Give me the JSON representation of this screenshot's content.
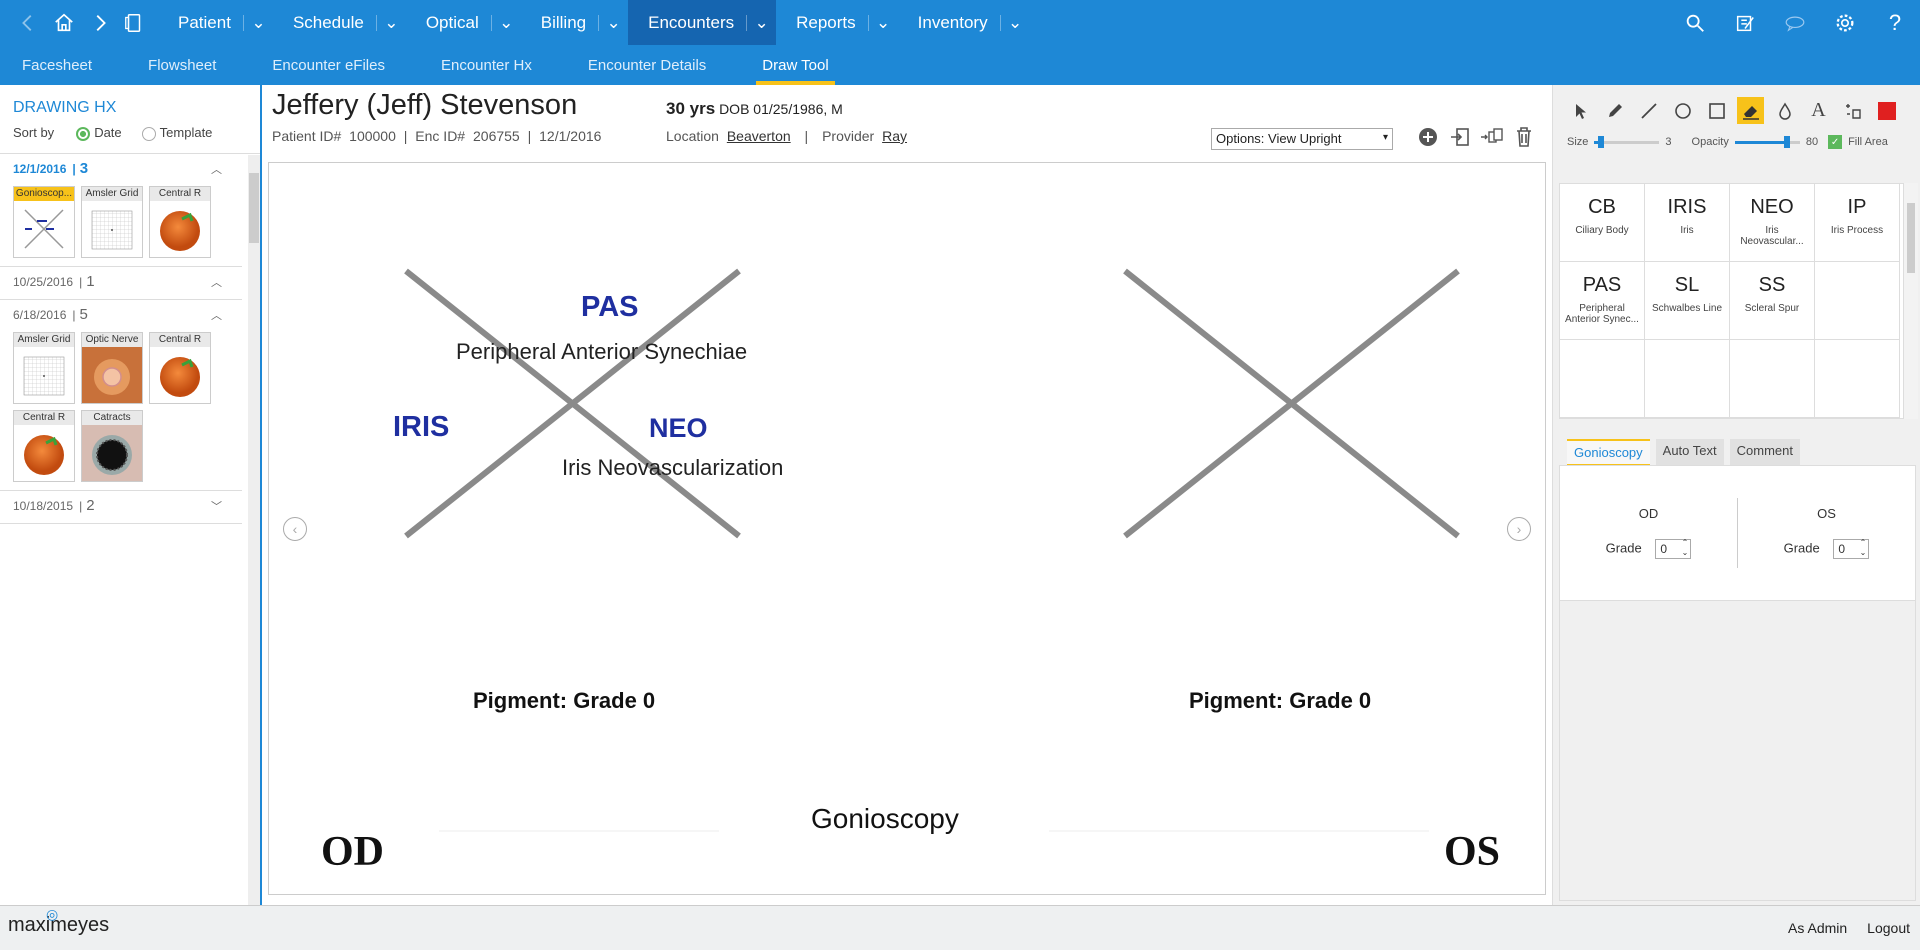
{
  "topnav": {
    "menus": [
      "Patient",
      "Schedule",
      "Optical",
      "Billing",
      "Encounters",
      "Reports",
      "Inventory"
    ],
    "active_menu": "Encounters"
  },
  "subnav": {
    "tabs": [
      "Facesheet",
      "Flowsheet",
      "Encounter eFiles",
      "Encounter Hx",
      "Encounter Details",
      "Draw Tool"
    ],
    "active_tab": "Draw Tool"
  },
  "drawing_hx": {
    "title": "DRAWING HX",
    "sort_by_label": "Sort by",
    "sort_options": [
      "Date",
      "Template"
    ],
    "sort_selected": "Date",
    "groups": [
      {
        "date": "12/1/2016",
        "count": "3",
        "thumbnails": [
          "Gonioscop...",
          "Amsler Grid",
          "Central R"
        ]
      },
      {
        "date": "10/25/2016",
        "count": "1",
        "thumbnails": []
      },
      {
        "date": "6/18/2016",
        "count": "5",
        "thumbnails": [
          "Amsler Grid",
          "Optic Nerve",
          "Central R",
          "Central R",
          "Catracts"
        ]
      },
      {
        "date": "10/18/2015",
        "count": "2",
        "thumbnails": []
      }
    ]
  },
  "patient": {
    "name": "Jeffery (Jeff) Stevenson",
    "id_label": "Patient ID#",
    "id": "100000",
    "enc_label": "Enc ID#",
    "enc_id": "206755",
    "enc_date": "12/1/2016",
    "age": "30 yrs",
    "dob": "DOB 01/25/1986, M",
    "location_label": "Location",
    "location": "Beaverton",
    "provider_label": "Provider",
    "provider": "Ray"
  },
  "options_select": "Options: View Upright",
  "drawing": {
    "title": "Gonioscopy",
    "od_label": "OD",
    "os_label": "OS",
    "pigment_od": "Pigment: Grade 0",
    "pigment_os": "Pigment: Grade 0",
    "annotations": {
      "pas": "PAS",
      "pas_desc": "Peripheral Anterior Synechiae",
      "iris": "IRIS",
      "neo": "NEO",
      "neo_desc": "Iris Neovascularization"
    }
  },
  "toolbar": {
    "size_label": "Size",
    "size_value": "3",
    "size_fraction": 0.1,
    "opacity_label": "Opacity",
    "opacity_value": "80",
    "opacity_fraction": 0.8,
    "fill_area_label": "Fill Area",
    "color": "#e02020"
  },
  "abbreviations": [
    {
      "abbr": "CB",
      "desc": "Ciliary Body"
    },
    {
      "abbr": "IRIS",
      "desc": "Iris"
    },
    {
      "abbr": "NEO",
      "desc": "Iris Neovascular..."
    },
    {
      "abbr": "IP",
      "desc": "Iris Process"
    },
    {
      "abbr": "PAS",
      "desc": "Peripheral Anterior Synec..."
    },
    {
      "abbr": "SL",
      "desc": "Schwalbes Line"
    },
    {
      "abbr": "SS",
      "desc": "Scleral Spur"
    }
  ],
  "panel_tabs": [
    "Gonioscopy",
    "Auto Text",
    "Comment"
  ],
  "gonioscopy_panel": {
    "od_label": "OD",
    "os_label": "OS",
    "grade_label": "Grade",
    "od_grade": "0",
    "os_grade": "0"
  },
  "footer": {
    "logo": "maximeyes",
    "user": "As Admin",
    "logout": "Logout"
  },
  "colors": {
    "primary": "#1e88d6",
    "active_nav": "#1565b0",
    "accent": "#f7c21a",
    "annotation_blue": "#1f2fa0"
  }
}
